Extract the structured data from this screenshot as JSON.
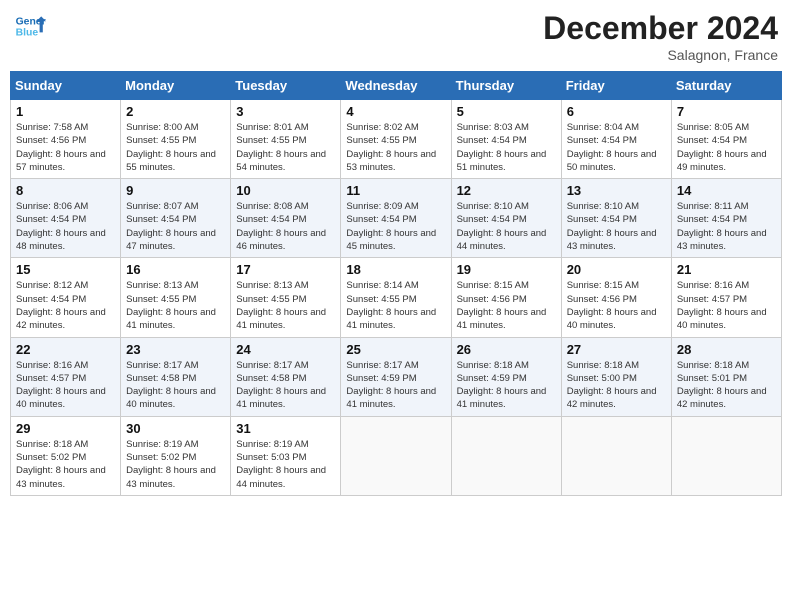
{
  "header": {
    "logo_line1": "General",
    "logo_line2": "Blue",
    "month_title": "December 2024",
    "subtitle": "Salagnon, France"
  },
  "weekdays": [
    "Sunday",
    "Monday",
    "Tuesday",
    "Wednesday",
    "Thursday",
    "Friday",
    "Saturday"
  ],
  "weeks": [
    [
      {
        "day": "1",
        "sunrise": "Sunrise: 7:58 AM",
        "sunset": "Sunset: 4:56 PM",
        "daylight": "Daylight: 8 hours and 57 minutes."
      },
      {
        "day": "2",
        "sunrise": "Sunrise: 8:00 AM",
        "sunset": "Sunset: 4:55 PM",
        "daylight": "Daylight: 8 hours and 55 minutes."
      },
      {
        "day": "3",
        "sunrise": "Sunrise: 8:01 AM",
        "sunset": "Sunset: 4:55 PM",
        "daylight": "Daylight: 8 hours and 54 minutes."
      },
      {
        "day": "4",
        "sunrise": "Sunrise: 8:02 AM",
        "sunset": "Sunset: 4:55 PM",
        "daylight": "Daylight: 8 hours and 53 minutes."
      },
      {
        "day": "5",
        "sunrise": "Sunrise: 8:03 AM",
        "sunset": "Sunset: 4:54 PM",
        "daylight": "Daylight: 8 hours and 51 minutes."
      },
      {
        "day": "6",
        "sunrise": "Sunrise: 8:04 AM",
        "sunset": "Sunset: 4:54 PM",
        "daylight": "Daylight: 8 hours and 50 minutes."
      },
      {
        "day": "7",
        "sunrise": "Sunrise: 8:05 AM",
        "sunset": "Sunset: 4:54 PM",
        "daylight": "Daylight: 8 hours and 49 minutes."
      }
    ],
    [
      {
        "day": "8",
        "sunrise": "Sunrise: 8:06 AM",
        "sunset": "Sunset: 4:54 PM",
        "daylight": "Daylight: 8 hours and 48 minutes."
      },
      {
        "day": "9",
        "sunrise": "Sunrise: 8:07 AM",
        "sunset": "Sunset: 4:54 PM",
        "daylight": "Daylight: 8 hours and 47 minutes."
      },
      {
        "day": "10",
        "sunrise": "Sunrise: 8:08 AM",
        "sunset": "Sunset: 4:54 PM",
        "daylight": "Daylight: 8 hours and 46 minutes."
      },
      {
        "day": "11",
        "sunrise": "Sunrise: 8:09 AM",
        "sunset": "Sunset: 4:54 PM",
        "daylight": "Daylight: 8 hours and 45 minutes."
      },
      {
        "day": "12",
        "sunrise": "Sunrise: 8:10 AM",
        "sunset": "Sunset: 4:54 PM",
        "daylight": "Daylight: 8 hours and 44 minutes."
      },
      {
        "day": "13",
        "sunrise": "Sunrise: 8:10 AM",
        "sunset": "Sunset: 4:54 PM",
        "daylight": "Daylight: 8 hours and 43 minutes."
      },
      {
        "day": "14",
        "sunrise": "Sunrise: 8:11 AM",
        "sunset": "Sunset: 4:54 PM",
        "daylight": "Daylight: 8 hours and 43 minutes."
      }
    ],
    [
      {
        "day": "15",
        "sunrise": "Sunrise: 8:12 AM",
        "sunset": "Sunset: 4:54 PM",
        "daylight": "Daylight: 8 hours and 42 minutes."
      },
      {
        "day": "16",
        "sunrise": "Sunrise: 8:13 AM",
        "sunset": "Sunset: 4:55 PM",
        "daylight": "Daylight: 8 hours and 41 minutes."
      },
      {
        "day": "17",
        "sunrise": "Sunrise: 8:13 AM",
        "sunset": "Sunset: 4:55 PM",
        "daylight": "Daylight: 8 hours and 41 minutes."
      },
      {
        "day": "18",
        "sunrise": "Sunrise: 8:14 AM",
        "sunset": "Sunset: 4:55 PM",
        "daylight": "Daylight: 8 hours and 41 minutes."
      },
      {
        "day": "19",
        "sunrise": "Sunrise: 8:15 AM",
        "sunset": "Sunset: 4:56 PM",
        "daylight": "Daylight: 8 hours and 41 minutes."
      },
      {
        "day": "20",
        "sunrise": "Sunrise: 8:15 AM",
        "sunset": "Sunset: 4:56 PM",
        "daylight": "Daylight: 8 hours and 40 minutes."
      },
      {
        "day": "21",
        "sunrise": "Sunrise: 8:16 AM",
        "sunset": "Sunset: 4:57 PM",
        "daylight": "Daylight: 8 hours and 40 minutes."
      }
    ],
    [
      {
        "day": "22",
        "sunrise": "Sunrise: 8:16 AM",
        "sunset": "Sunset: 4:57 PM",
        "daylight": "Daylight: 8 hours and 40 minutes."
      },
      {
        "day": "23",
        "sunrise": "Sunrise: 8:17 AM",
        "sunset": "Sunset: 4:58 PM",
        "daylight": "Daylight: 8 hours and 40 minutes."
      },
      {
        "day": "24",
        "sunrise": "Sunrise: 8:17 AM",
        "sunset": "Sunset: 4:58 PM",
        "daylight": "Daylight: 8 hours and 41 minutes."
      },
      {
        "day": "25",
        "sunrise": "Sunrise: 8:17 AM",
        "sunset": "Sunset: 4:59 PM",
        "daylight": "Daylight: 8 hours and 41 minutes."
      },
      {
        "day": "26",
        "sunrise": "Sunrise: 8:18 AM",
        "sunset": "Sunset: 4:59 PM",
        "daylight": "Daylight: 8 hours and 41 minutes."
      },
      {
        "day": "27",
        "sunrise": "Sunrise: 8:18 AM",
        "sunset": "Sunset: 5:00 PM",
        "daylight": "Daylight: 8 hours and 42 minutes."
      },
      {
        "day": "28",
        "sunrise": "Sunrise: 8:18 AM",
        "sunset": "Sunset: 5:01 PM",
        "daylight": "Daylight: 8 hours and 42 minutes."
      }
    ],
    [
      {
        "day": "29",
        "sunrise": "Sunrise: 8:18 AM",
        "sunset": "Sunset: 5:02 PM",
        "daylight": "Daylight: 8 hours and 43 minutes."
      },
      {
        "day": "30",
        "sunrise": "Sunrise: 8:19 AM",
        "sunset": "Sunset: 5:02 PM",
        "daylight": "Daylight: 8 hours and 43 minutes."
      },
      {
        "day": "31",
        "sunrise": "Sunrise: 8:19 AM",
        "sunset": "Sunset: 5:03 PM",
        "daylight": "Daylight: 8 hours and 44 minutes."
      },
      null,
      null,
      null,
      null
    ]
  ]
}
